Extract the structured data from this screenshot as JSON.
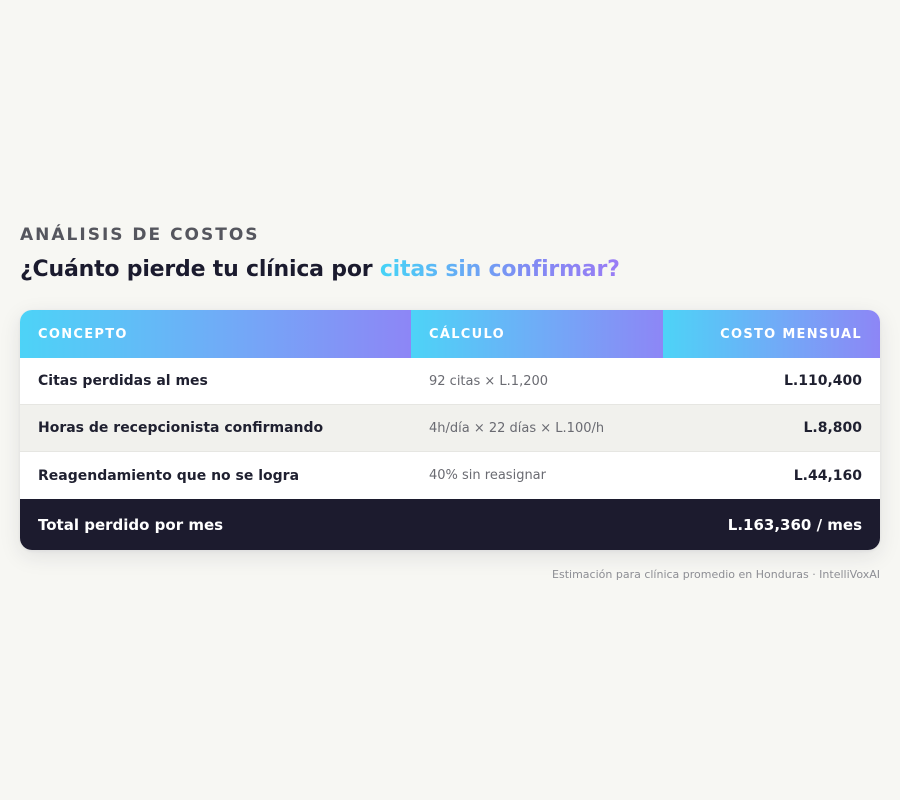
{
  "section": {
    "eyebrow": "ANÁLISIS DE COSTOS",
    "headline_prefix": "¿Cuánto pierde tu clínica por ",
    "headline_highlight": "citas sin confirmar?"
  },
  "table": {
    "headers": {
      "concept": "CONCEPTO",
      "calculation": "CÁLCULO",
      "monthly_cost": "COSTO MENSUAL"
    },
    "rows": [
      {
        "concept": "Citas perdidas al mes",
        "calculation": "92 citas × L.1,200",
        "cost": "L.110,400"
      },
      {
        "concept": "Horas de recepcionista confirmando",
        "calculation": "4h/día × 22 días × L.100/h",
        "cost": "L.8,800"
      },
      {
        "concept": "Reagendamiento que no se logra",
        "calculation": "40% sin reasignar",
        "cost": "L.44,160"
      }
    ],
    "total": {
      "label": "Total perdido por mes",
      "value": "L.163,360 / mes"
    }
  },
  "footnote": "Estimación para clínica promedio en Honduras · IntelliVoxAI",
  "colors": {
    "background": "#f7f7f3",
    "header_gradient_start": "#4dd3f7",
    "header_gradient_end": "#8d86f6",
    "total_row_bg": "#1c1b2e",
    "text_dark": "#1b1b2e"
  }
}
